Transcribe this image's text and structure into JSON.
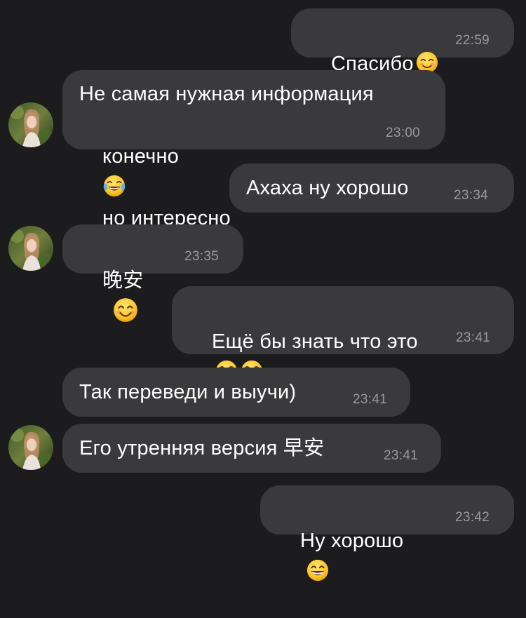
{
  "messages": [
    {
      "id": "m1",
      "direction": "outgoing",
      "text": "Спасибо",
      "emoji_after": "smiling-face-icon",
      "time": "22:59"
    },
    {
      "id": "m2",
      "direction": "incoming",
      "line1": "Не самая нужная информация",
      "line2_a": "конечно",
      "line2_emoji": "face-with-tears-of-joy-icon",
      "line2_b": "но интересно",
      "time": "23:00"
    },
    {
      "id": "m3",
      "direction": "outgoing",
      "text": "Ахаха ну хорошо",
      "time": "23:34"
    },
    {
      "id": "m4",
      "direction": "incoming",
      "text": "晚安",
      "emoji_after": "smiling-face-with-smiling-eyes-icon",
      "time": "23:35"
    },
    {
      "id": "m5",
      "direction": "outgoing",
      "text": "Ещё бы знать что это",
      "emoji_after": "face-with-tears-of-joy-icon",
      "time": "23:41"
    },
    {
      "id": "m6",
      "direction": "incoming",
      "text": "Так переведи и выучи)",
      "time": "23:41"
    },
    {
      "id": "m7",
      "direction": "incoming",
      "text": "Его утренняя версия 早安",
      "time": "23:41"
    },
    {
      "id": "m8",
      "direction": "outgoing",
      "text": "Ну хорошо",
      "emoji_after": "grinning-face-with-smiling-eyes-icon",
      "time": "23:42"
    }
  ],
  "colors": {
    "background": "#1c1c1e",
    "bubble": "#3a3a3c",
    "timestamp": "#9a9a9e",
    "text": "#ffffff"
  }
}
